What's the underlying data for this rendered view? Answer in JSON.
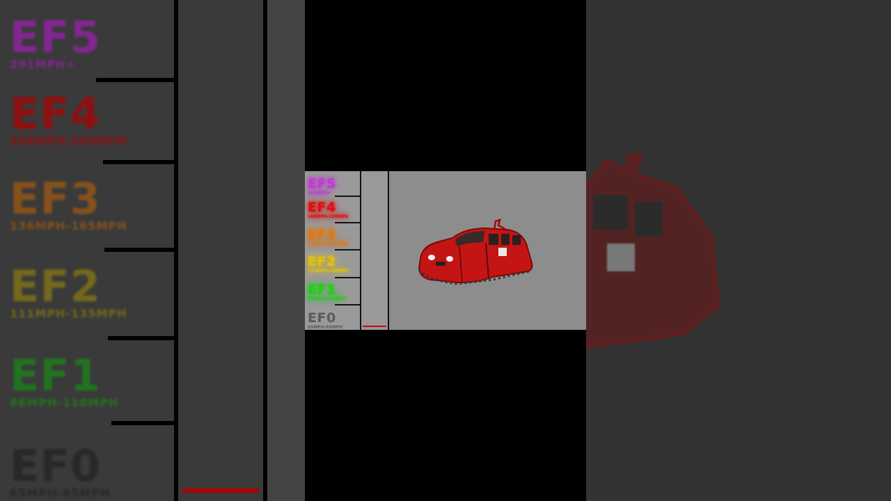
{
  "scale": {
    "levels": [
      {
        "name": "EF5",
        "speed": "201MPH+",
        "color": "#c23bd4"
      },
      {
        "name": "EF4",
        "speed": "166MPH-200MPH",
        "color": "#e01010"
      },
      {
        "name": "EF3",
        "speed": "136MPH-165MPH",
        "color": "#e07a10"
      },
      {
        "name": "EF2",
        "speed": "111MPH-135MPH",
        "color": "#e0c010"
      },
      {
        "name": "EF1",
        "speed": "86MPH-110MPH",
        "color": "#22d01a"
      },
      {
        "name": "EF0",
        "speed": "65MPH-85MPH",
        "color": "#5a5a5a"
      }
    ],
    "meter_level": 0.02,
    "meter_color": "#d00000"
  },
  "car": {
    "body_color": "#c41414",
    "sign_icon": "placard-icon"
  }
}
